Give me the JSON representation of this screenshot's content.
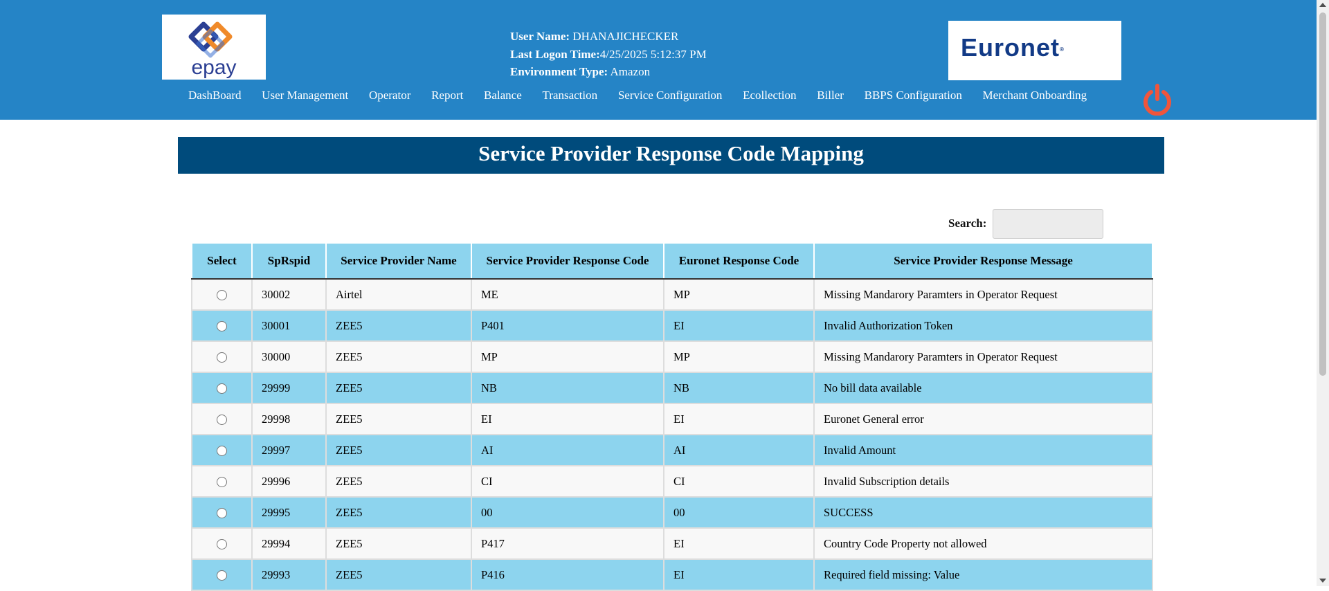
{
  "header": {
    "logo_left_text": "epay",
    "logo_right_text": "Euronet",
    "logo_right_reg": "®",
    "user_name_label": "User Name:",
    "user_name_value": " DHANAJICHECKER",
    "logon_label": "Last Logon Time:",
    "logon_value": "4/25/2025 5:12:37 PM",
    "env_label": "Environment Type:",
    "env_value": " Amazon",
    "power_icon": "power-icon",
    "accent_color": "#2584c6",
    "power_color": "#f0553c"
  },
  "nav": [
    {
      "label": "DashBoard"
    },
    {
      "label": "User Management"
    },
    {
      "label": "Operator"
    },
    {
      "label": "Report"
    },
    {
      "label": "Balance"
    },
    {
      "label": "Transaction"
    },
    {
      "label": "Service Configuration"
    },
    {
      "label": "Ecollection"
    },
    {
      "label": "Biller"
    },
    {
      "label": "BBPS Configuration"
    },
    {
      "label": "Merchant Onboarding"
    }
  ],
  "page": {
    "title": "Service Provider Response Code Mapping",
    "title_bg": "#004b7c"
  },
  "search": {
    "label": "Search:",
    "value": ""
  },
  "table": {
    "columns": [
      "Select",
      "SpRspid",
      "Service Provider Name",
      "Service Provider Response Code",
      "Euronet Response Code",
      "Service Provider Response Message"
    ],
    "rows": [
      [
        "30002",
        "Airtel",
        "ME",
        "MP",
        "Missing Mandarory Paramters in Operator Request"
      ],
      [
        "30001",
        "ZEE5",
        "P401",
        "EI",
        "Invalid Authorization Token"
      ],
      [
        "30000",
        "ZEE5",
        "MP",
        "MP",
        "Missing Mandarory Paramters in Operator Request"
      ],
      [
        "29999",
        "ZEE5",
        "NB",
        "NB",
        "No bill data available"
      ],
      [
        "29998",
        "ZEE5",
        "EI",
        "EI",
        "Euronet General error"
      ],
      [
        "29997",
        "ZEE5",
        "AI",
        "AI",
        "Invalid Amount"
      ],
      [
        "29996",
        "ZEE5",
        "CI",
        "CI",
        "Invalid Subscription details"
      ],
      [
        "29995",
        "ZEE5",
        "00",
        "00",
        "SUCCESS"
      ],
      [
        "29994",
        "ZEE5",
        "P417",
        "EI",
        "Country Code Property not allowed"
      ],
      [
        "29993",
        "ZEE5",
        "P416",
        "EI",
        "Required field missing: Value"
      ]
    ]
  }
}
